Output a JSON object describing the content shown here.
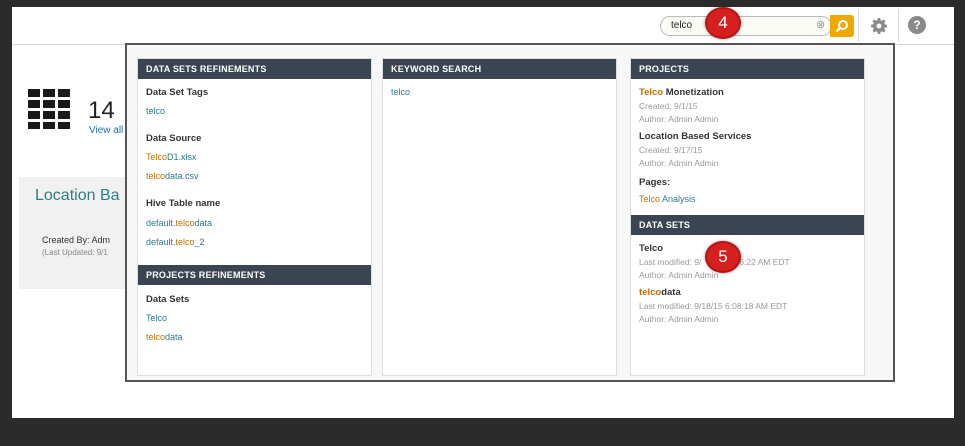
{
  "search": {
    "value": "telco",
    "clear_glyph": "⊗"
  },
  "help_glyph": "?",
  "badges": {
    "step4": "4",
    "step5": "5"
  },
  "background": {
    "count": "14",
    "view_all": "View all",
    "card_title": "Location Ba",
    "created_by": "Created By:  Adm",
    "last_updated": "(Last Updated: 9/1"
  },
  "popup": {
    "datasets_refinements": {
      "header": "DATA SETS REFINEMENTS",
      "tags_label": "Data Set Tags",
      "tag": "telco",
      "source_label": "Data Source",
      "source_1": {
        "match": "Telco",
        "rest": "D1.xlsx"
      },
      "source_2": {
        "match": "telco",
        "rest": "data.csv"
      },
      "hive_label": "Hive Table name",
      "hive_1": {
        "pre": "default.",
        "match": "telco",
        "rest": "data"
      },
      "hive_2": {
        "pre": "default.",
        "match": "telco",
        "rest": "_2"
      }
    },
    "projects_refinements": {
      "header": "PROJECTS REFINEMENTS",
      "label": "Data Sets",
      "item_1": "Telco",
      "item_2": {
        "match": "telco",
        "rest": "data"
      }
    },
    "keyword_search": {
      "header": "KEYWORD SEARCH",
      "result": "telco"
    },
    "projects": {
      "header": "PROJECTS",
      "p1": {
        "match": "Telco",
        "rest": " Monetization",
        "created": "Created: 9/1/15",
        "author": "Author: Admin Admin"
      },
      "p2": {
        "title": "Location Based Services",
        "created": "Created: 9/17/15",
        "author": "Author: Admin Admin"
      },
      "pages_label": "Pages:",
      "page_1": {
        "match": "Telco",
        "rest": " Analysis"
      }
    },
    "data_sets": {
      "header": "DATA SETS",
      "d1": {
        "match": "Telco",
        "modified": "Last modified: 9/",
        "modified_tail": "6:06:22 AM EDT",
        "author": "Author: Admin Admin"
      },
      "d2": {
        "match": "telco",
        "rest": "data",
        "modified": "Last modified: 9/18/15 6:08:18 AM EDT",
        "author": "Author: Admin Admin"
      }
    }
  },
  "colors": {
    "header_bg": "#3b4451",
    "highlight": "#c07000",
    "link": "#2a7a8a",
    "search_button": "#f0a800",
    "badge": "#d62020"
  }
}
